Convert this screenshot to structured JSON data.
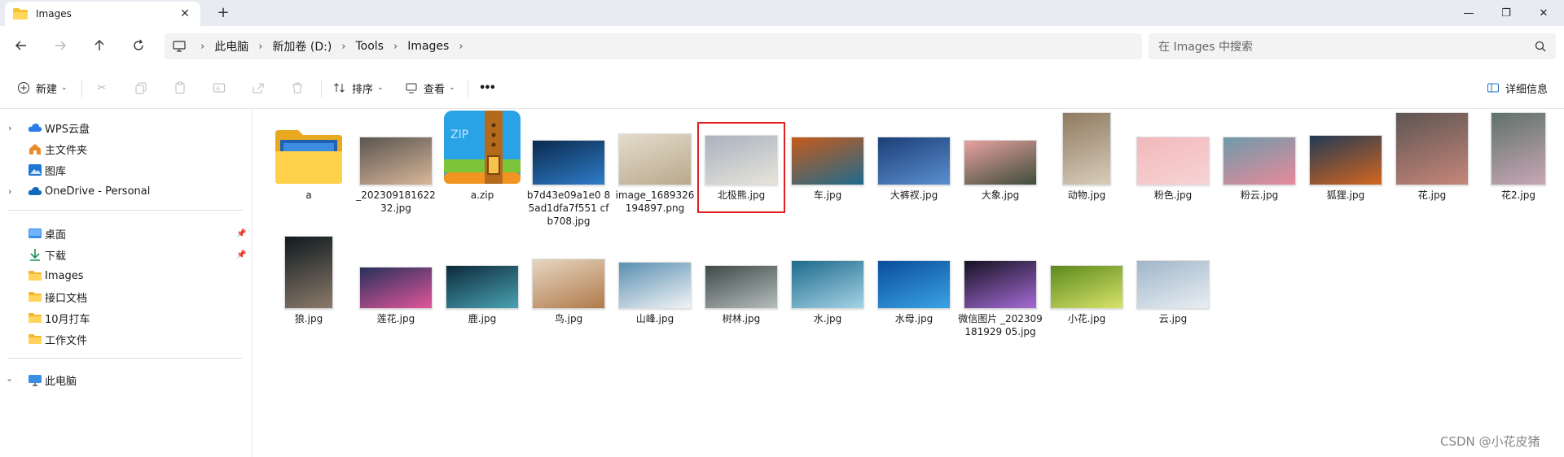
{
  "window": {
    "tab_title": "Images",
    "tab_close": "✕",
    "new_tab": "+",
    "minimize": "—",
    "restore": "❐",
    "close": "✕"
  },
  "nav": {
    "breadcrumbs": [
      "此电脑",
      "新加卷 (D:)",
      "Tools",
      "Images"
    ],
    "search_placeholder": "在 Images 中搜索"
  },
  "commands": {
    "new": "新建",
    "sort": "排序",
    "view": "查看",
    "more": "•••",
    "details": "详细信息"
  },
  "sidebar": {
    "top_items": [
      {
        "label": "WPS云盘",
        "icon": "cloud-icon",
        "expandable": true
      },
      {
        "label": "主文件夹",
        "icon": "home-icon",
        "expandable": false
      },
      {
        "label": "图库",
        "icon": "gallery-icon",
        "expandable": false
      },
      {
        "label": "OneDrive - Personal",
        "icon": "onedrive-icon",
        "expandable": true
      }
    ],
    "quick_items": [
      {
        "label": "桌面",
        "icon": "desktop-icon",
        "pinned": true
      },
      {
        "label": "下载",
        "icon": "download-icon",
        "pinned": true
      },
      {
        "label": "Images",
        "icon": "folder-icon",
        "pinned": false
      },
      {
        "label": "接口文档",
        "icon": "folder-icon",
        "pinned": false
      },
      {
        "label": "10月打车",
        "icon": "folder-icon",
        "pinned": false
      },
      {
        "label": "工作文件",
        "icon": "folder-icon",
        "pinned": false
      }
    ],
    "this_pc": "此电脑"
  },
  "files": [
    {
      "name": "a",
      "kind": "folder"
    },
    {
      "name": "_202309181622 32.jpg",
      "kind": "image",
      "colors": [
        "#5a5550",
        "#d9b79a"
      ]
    },
    {
      "name": "a.zip",
      "kind": "zip"
    },
    {
      "name": "b7d43e09a1e0 85ad1dfa7f551 cfb708.jpg",
      "kind": "image",
      "colors": [
        "#0b2a4e",
        "#2e7dc9"
      ]
    },
    {
      "name": "image_1689326 194897.png",
      "kind": "image",
      "colors": [
        "#e4dccb",
        "#b9a98d"
      ]
    },
    {
      "name": "北极熊.jpg",
      "kind": "image",
      "colors": [
        "#a9b2bf",
        "#e8e4db"
      ],
      "selected": true
    },
    {
      "name": "车.jpg",
      "kind": "image",
      "colors": [
        "#c65a1a",
        "#1e6b8e"
      ]
    },
    {
      "name": "大裤衩.jpg",
      "kind": "image",
      "colors": [
        "#1b3f77",
        "#5b8fcf"
      ]
    },
    {
      "name": "大象.jpg",
      "kind": "image",
      "colors": [
        "#e7a2a0",
        "#3e4c3a"
      ]
    },
    {
      "name": "动物.jpg",
      "kind": "image",
      "colors": [
        "#8f7a60",
        "#d8cdbb"
      ]
    },
    {
      "name": "粉色.jpg",
      "kind": "image",
      "colors": [
        "#f2b8bc",
        "#f7d4d4"
      ]
    },
    {
      "name": "粉云.jpg",
      "kind": "image",
      "colors": [
        "#6f9aab",
        "#e88a9a"
      ]
    },
    {
      "name": "狐狸.jpg",
      "kind": "image",
      "colors": [
        "#223a55",
        "#d4661f"
      ]
    },
    {
      "name": "花.jpg",
      "kind": "image",
      "colors": [
        "#5d5552",
        "#c7867a"
      ]
    },
    {
      "name": "花2.jpg",
      "kind": "image",
      "colors": [
        "#5e726b",
        "#c9a7b5"
      ]
    },
    {
      "name": "狼.jpg",
      "kind": "image",
      "colors": [
        "#0e1a1f",
        "#8c7a6a"
      ]
    },
    {
      "name": "莲花.jpg",
      "kind": "image",
      "colors": [
        "#28305a",
        "#e2569b"
      ]
    },
    {
      "name": "鹿.jpg",
      "kind": "image",
      "colors": [
        "#0c2a3b",
        "#4aa3b3"
      ]
    },
    {
      "name": "鸟.jpg",
      "kind": "image",
      "colors": [
        "#e6d6c2",
        "#b07a4a"
      ]
    },
    {
      "name": "山峰.jpg",
      "kind": "image",
      "colors": [
        "#5a8fb2",
        "#f2f4f5"
      ]
    },
    {
      "name": "树林.jpg",
      "kind": "image",
      "colors": [
        "#3f4a48",
        "#b5bebd"
      ]
    },
    {
      "name": "水.jpg",
      "kind": "image",
      "colors": [
        "#1e6b8c",
        "#a5d3e6"
      ]
    },
    {
      "name": "水母.jpg",
      "kind": "image",
      "colors": [
        "#0a4d9c",
        "#3aa3e6"
      ]
    },
    {
      "name": "微信图片 _202309181929 05.jpg",
      "kind": "image",
      "colors": [
        "#151223",
        "#a66bd6"
      ]
    },
    {
      "name": "小花.jpg",
      "kind": "image",
      "colors": [
        "#5c8a1c",
        "#d8e36a"
      ]
    },
    {
      "name": "云.jpg",
      "kind": "image",
      "colors": [
        "#9fb6c9",
        "#e9eef3"
      ]
    }
  ],
  "watermark": "CSDN @小花皮猪"
}
